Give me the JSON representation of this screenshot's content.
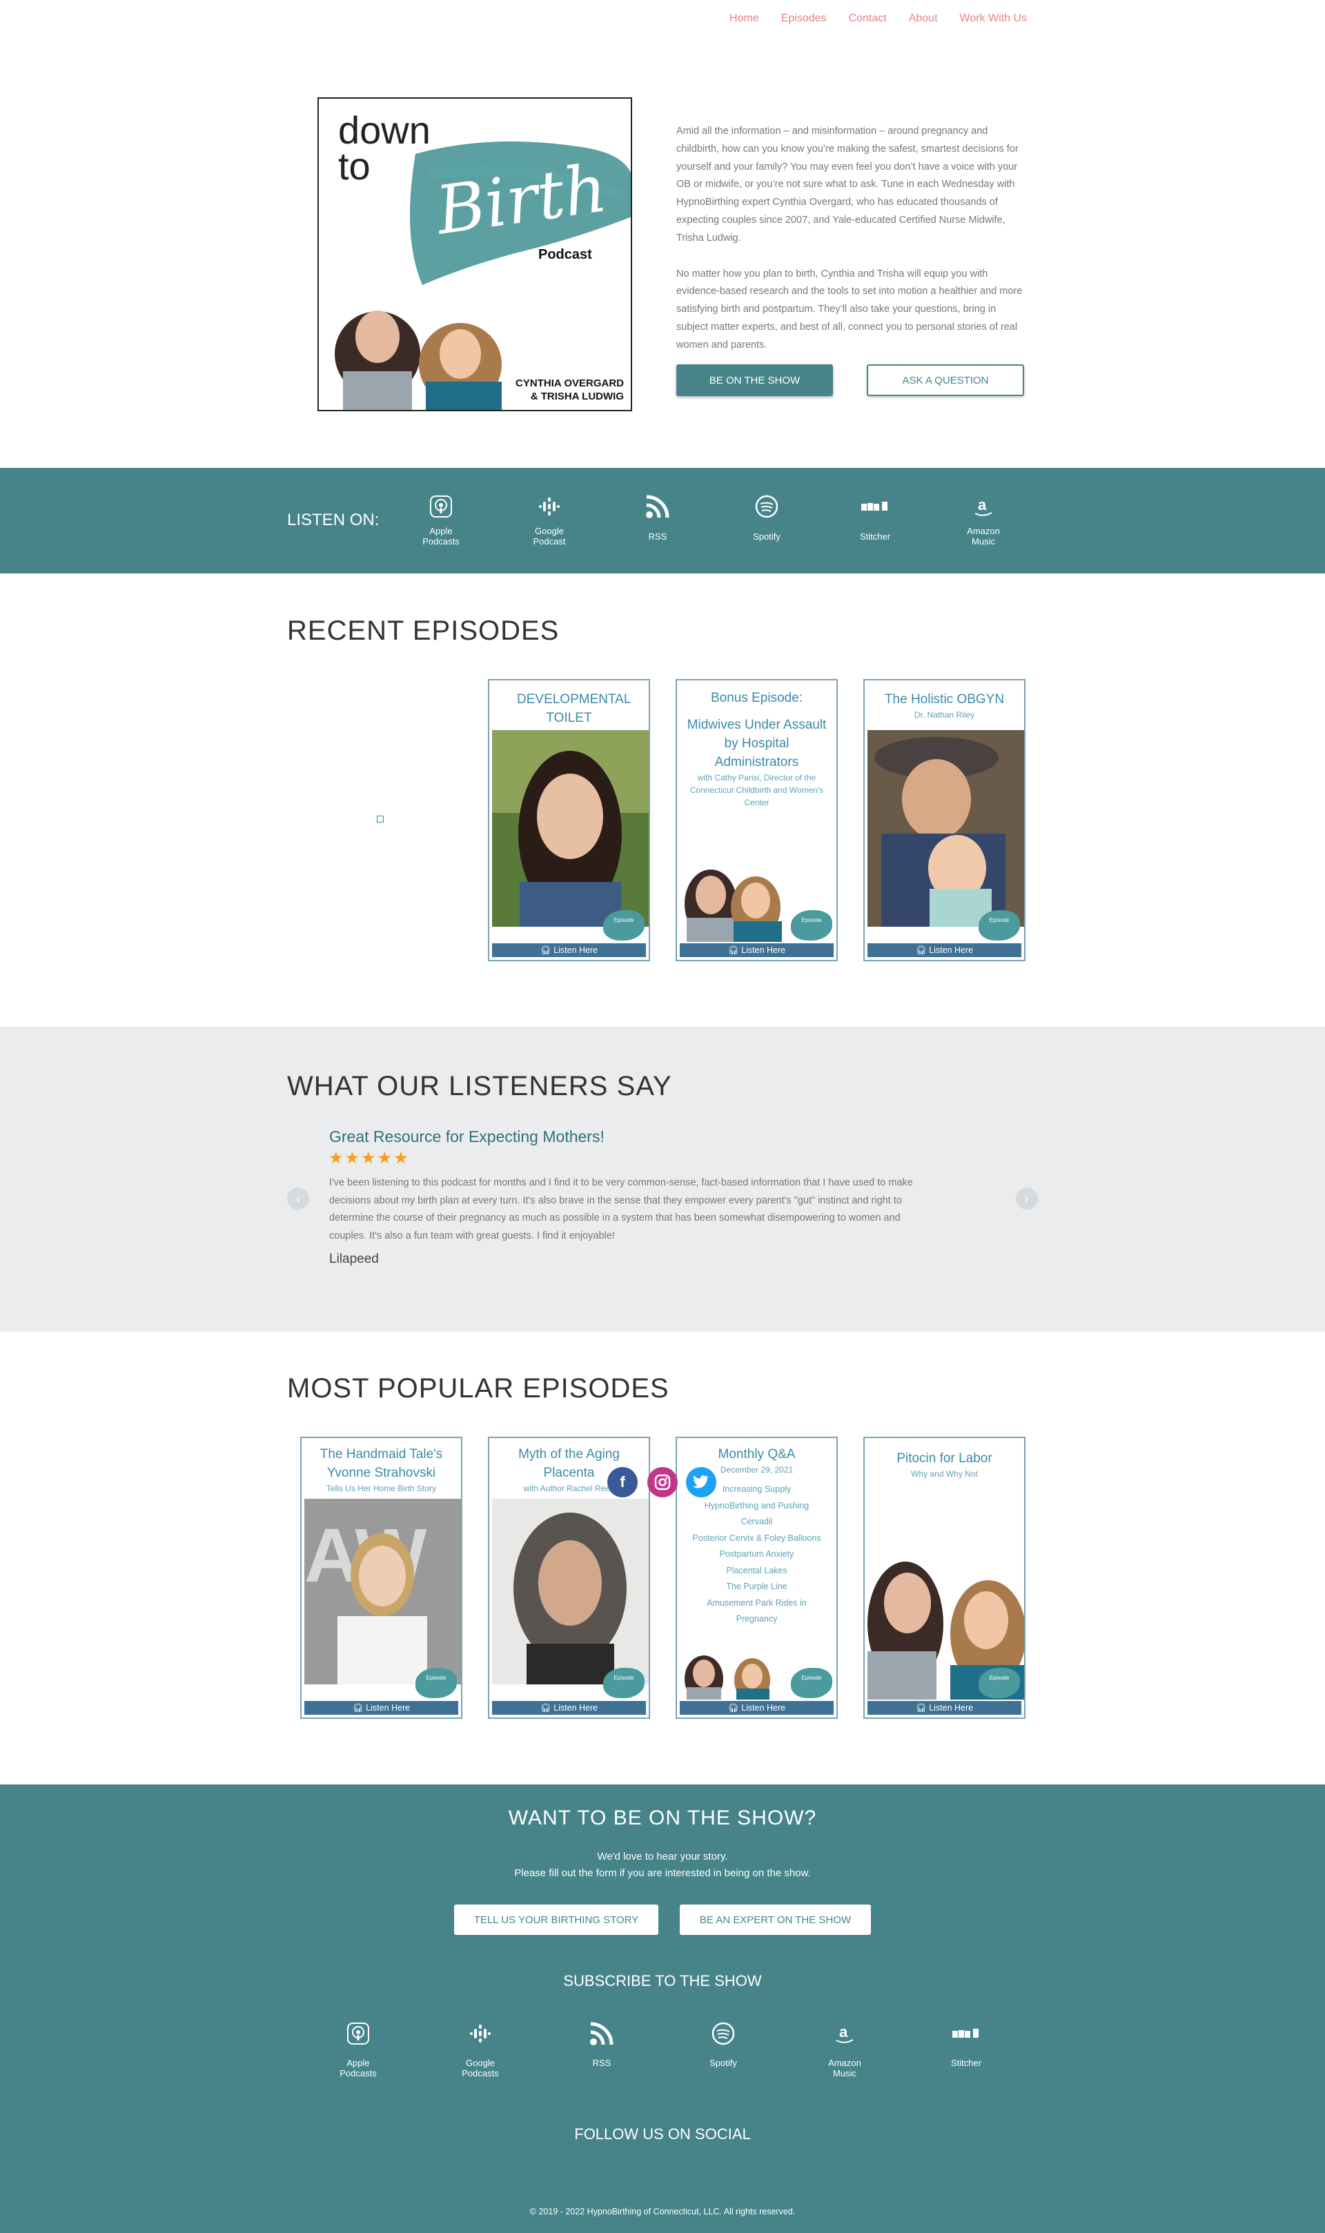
{
  "nav": {
    "items": [
      "Home",
      "Episodes",
      "Contact",
      "About",
      "Work With Us"
    ]
  },
  "hero": {
    "logo": {
      "line1": "down",
      "line2": "to",
      "script": "Birth",
      "podcast": "Podcast",
      "hosts1": "CYNTHIA OVERGARD",
      "hosts2": "& TRISHA LUDWIG"
    },
    "para1": "Amid all the information – and misinformation – around pregnancy and childbirth, how can you know you’re making the safest, smartest decisions for yourself and your family? You may even feel you don’t have a voice with your OB or midwife, or you’re not sure what to ask. Tune in each Wednesday with HypnoBirthing expert Cynthia Overgard, who has educated thousands of expecting couples since 2007, and Yale-educated Certified Nurse Midwife, Trisha Ludwig.",
    "para2": "No matter how you plan to birth, Cynthia and Trisha will equip you with evidence-based research and the tools to set into motion a healthier and more satisfying birth and postpartum. They’ll also take your questions, bring in subject matter experts, and best of all, connect you to personal stories of real women and parents.",
    "btn_show": "BE ON THE SHOW",
    "btn_question": "ASK A QUESTION"
  },
  "listen": {
    "label": "LISTEN ON:",
    "platforms": [
      {
        "l1": "Apple",
        "l2": "Podcasts"
      },
      {
        "l1": "Google",
        "l2": "Podcast"
      },
      {
        "l1": "RSS",
        "l2": ""
      },
      {
        "l1": "Spotify",
        "l2": ""
      },
      {
        "l1": "Stitcher",
        "l2": ""
      },
      {
        "l1": "Amazon",
        "l2": "Music"
      }
    ]
  },
  "recent": {
    "title": "RECENT EPISODES",
    "cards": [
      {
        "t": "DEVELOPMENTAL TOILET TRAINING",
        "s": ""
      },
      {
        "t": "Bonus Episode:",
        "t2": "Midwives Under Assault by Hospital Administrators",
        "s": "with Cathy Parisi, Director of the Connecticut Childbirth and Women's Center"
      },
      {
        "t": "The Holistic OBGYN",
        "s": "Dr. Nathan Riley"
      }
    ],
    "listen_here": "Listen Here",
    "stamp": "Episode"
  },
  "testimonials": {
    "title": "WHAT OUR LISTENERS SAY",
    "heading": "Great Resource for Expecting Mothers!",
    "stars": "★★★★★",
    "body": "I've been listening to this podcast for months and I find it to be very common-sense, fact-based information that I have used to make decisions about my birth plan at every turn. It's also brave in the sense that they empower every parent's \"gut\" instinct and right to determine the course of their pregnancy as much as possible in a system that has been somewhat disempowering to women and couples. It's also a fun team with great guests. I find it enjoyable!",
    "author": "Lilapeed",
    "prev": "‹",
    "next": "›"
  },
  "popular": {
    "title": "MOST POPULAR EPISODES",
    "cards": [
      {
        "t": "The Handmaid Tale's Yvonne Strahovski",
        "s": "Tells Us Her Home Birth Story"
      },
      {
        "t": "Myth of the Aging Placenta",
        "s": "with Author Rachel Reed"
      },
      {
        "t": "Monthly Q&A",
        "s": "December 29, 2021",
        "list": [
          "Increasing Supply",
          "HypnoBirthing and Pushing",
          "Cervadil",
          "Posterior Cervix & Foley Balloons",
          "Postpartum Anxiety",
          "Placental Lakes",
          "The Purple Line",
          "Amusement Park Rides in Pregnancy"
        ]
      },
      {
        "t": "Pitocin for Labor",
        "s": "Why and Why Not"
      }
    ]
  },
  "footer": {
    "title": "WANT TO BE ON THE SHOW?",
    "line1": "We'd love to hear your story.",
    "line2": "Please fill out the form if you are interested in being on the show.",
    "btn_story": "TELL US YOUR BIRTHING STORY",
    "btn_expert": "BE AN EXPERT ON THE SHOW",
    "subscribe": "SUBSCRIBE TO THE SHOW",
    "platforms": [
      {
        "l1": "Apple",
        "l2": "Podcasts"
      },
      {
        "l1": "Google",
        "l2": "Podcasts"
      },
      {
        "l1": "RSS",
        "l2": ""
      },
      {
        "l1": "Spotify",
        "l2": ""
      },
      {
        "l1": "Amazon",
        "l2": "Music"
      },
      {
        "l1": "Stitcher",
        "l2": ""
      }
    ],
    "follow": "FOLLOW US ON SOCIAL",
    "copyright": "© 2019 - 2022 HypnoBirthing of Connecticut, LLC. All rights reserved."
  },
  "colors": {
    "teal": "#468489",
    "nav": "#e8808a",
    "card_border": "#7aa3b3",
    "star": "#f59e1b"
  }
}
